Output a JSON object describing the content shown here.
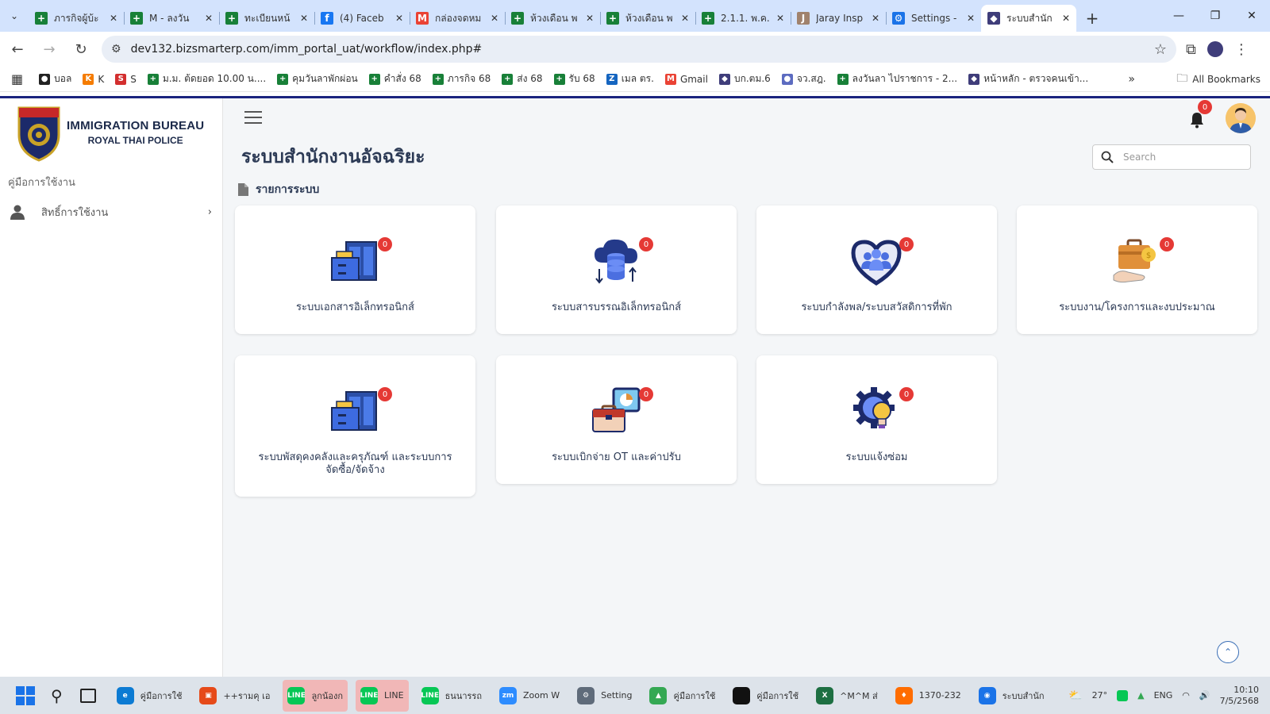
{
  "browser": {
    "tabs": [
      {
        "label": "ภารกิจผู้บ้ะ",
        "color": "#188038",
        "glyph": "+"
      },
      {
        "label": "M - ลงวัน",
        "color": "#188038",
        "glyph": "+"
      },
      {
        "label": "ทะเบียนหน้",
        "color": "#188038",
        "glyph": "+"
      },
      {
        "label": "(4) Faceb",
        "color": "#1877f2",
        "glyph": "f"
      },
      {
        "label": "กล่องจดหม",
        "color": "#ea4335",
        "glyph": "M"
      },
      {
        "label": "ห้วงเดือน พ",
        "color": "#188038",
        "glyph": "+"
      },
      {
        "label": "ห้วงเดือน พ",
        "color": "#188038",
        "glyph": "+"
      },
      {
        "label": "2.1.1. พ.ค.",
        "color": "#188038",
        "glyph": "+"
      },
      {
        "label": "Jaray Insp",
        "color": "#a0826d",
        "glyph": "J"
      },
      {
        "label": "Settings -",
        "color": "#1a73e8",
        "glyph": "⚙"
      },
      {
        "label": "ระบบสำนัก",
        "color": "#3f3d7a",
        "glyph": "◆",
        "active": true
      }
    ],
    "url": "dev132.bizsmarterp.com/imm_portal_uat/workflow/index.php#",
    "bookmarks": [
      {
        "label": "บอล",
        "color": "#222",
        "glyph": "●"
      },
      {
        "label": "K",
        "color": "#f57c00",
        "glyph": "K"
      },
      {
        "label": "S",
        "color": "#d32f2f",
        "glyph": "S"
      },
      {
        "label": "ม.ม. ต้ดยอด 10.00 น....",
        "color": "#188038",
        "glyph": "+"
      },
      {
        "label": "คุมวันลาพักผ่อน",
        "color": "#188038",
        "glyph": "+"
      },
      {
        "label": "คำสั่ง 68",
        "color": "#188038",
        "glyph": "+"
      },
      {
        "label": "ภารกิจ 68",
        "color": "#188038",
        "glyph": "+"
      },
      {
        "label": "ส่ง 68",
        "color": "#188038",
        "glyph": "+"
      },
      {
        "label": "รับ 68",
        "color": "#188038",
        "glyph": "+"
      },
      {
        "label": "เมล ตร.",
        "color": "#1565c0",
        "glyph": "Z"
      },
      {
        "label": "Gmail",
        "color": "#ea4335",
        "glyph": "M"
      },
      {
        "label": "บก.ตม.6",
        "color": "#3f3d7a",
        "glyph": "◆"
      },
      {
        "label": "จว.สฎ.",
        "color": "#5c6bc0",
        "glyph": "●"
      },
      {
        "label": "ลงวันลา ไปราชการ - 2...",
        "color": "#188038",
        "glyph": "+"
      },
      {
        "label": "หน้าหลัก - ตรวจคนเข้า...",
        "color": "#3f3d7a",
        "glyph": "◆"
      }
    ],
    "all_bookmarks": "All Bookmarks"
  },
  "sidebar": {
    "logo_line1": "IMMIGRATION BUREAU",
    "logo_line2": "ROYAL THAI POLICE",
    "manual": "คู่มือการใช้งาน",
    "items": [
      {
        "label": "สิทธิ์การใช้งาน"
      }
    ]
  },
  "header": {
    "notifications": "0",
    "title": "ระบบสำนักงานอัจฉริยะ",
    "search_placeholder": "Search"
  },
  "section": {
    "title": "รายการระบบ"
  },
  "cards": [
    {
      "label": "ระบบเอกสารอิเล็กทรอนิกส์",
      "badge": "0",
      "icon": "folder-cabinet-icon"
    },
    {
      "label": "ระบบสารบรรณอิเล็กทรอนิกส์",
      "badge": "0",
      "icon": "cloud-database-icon"
    },
    {
      "label": "ระบบกำลังพล/ระบบสวัสดิการที่พัก",
      "badge": "0",
      "icon": "heart-people-icon"
    },
    {
      "label": "ระบบงาน/โครงการและงบประมาณ",
      "badge": "0",
      "icon": "briefcase-money-icon"
    },
    {
      "label": "ระบบพัสดุคงคลังและครุภัณฑ์ และระบบการจัดซื้อ/จัดจ้าง",
      "badge": "0",
      "icon": "folder-cabinet-icon"
    },
    {
      "label": "ระบบเบิกจ่าย OT และค่าปรับ",
      "badge": "0",
      "icon": "briefcase-chart-icon"
    },
    {
      "label": "ระบบแจ้งซ่อม",
      "badge": "0",
      "icon": "gear-bulb-icon"
    }
  ],
  "taskbar": {
    "apps": [
      {
        "label": "คู่มือการใช้",
        "color": "#0c7bd3",
        "glyph": "e"
      },
      {
        "label": "++รามคุ เอ",
        "color": "#e64a19",
        "glyph": "▣"
      },
      {
        "label": "ลูกน้องก",
        "color": "#06c755",
        "glyph": "LINE",
        "hl": true
      },
      {
        "label": "LINE",
        "color": "#06c755",
        "glyph": "LINE",
        "hl": true
      },
      {
        "label": "ธนนารรถ",
        "color": "#06c755",
        "glyph": "LINE"
      },
      {
        "label": "Zoom W",
        "color": "#2d8cff",
        "glyph": "zm"
      },
      {
        "label": "Setting",
        "color": "#5f6b7a",
        "glyph": "⚙"
      },
      {
        "label": "คู่มือการใช้",
        "color": "#34a853",
        "glyph": "▲"
      },
      {
        "label": "คู่มือการใช้",
        "color": "#111",
        "glyph": ""
      },
      {
        "label": "^M^M ส่",
        "color": "#1d6f42",
        "glyph": "X"
      },
      {
        "label": "1370-232",
        "color": "#ff6d00",
        "glyph": "♦"
      },
      {
        "label": "ระบบสำนัก",
        "color": "#1a73e8",
        "glyph": "◉"
      }
    ],
    "weather": "27°",
    "lang": "ENG",
    "time": "10:10",
    "date": "7/5/2568"
  }
}
